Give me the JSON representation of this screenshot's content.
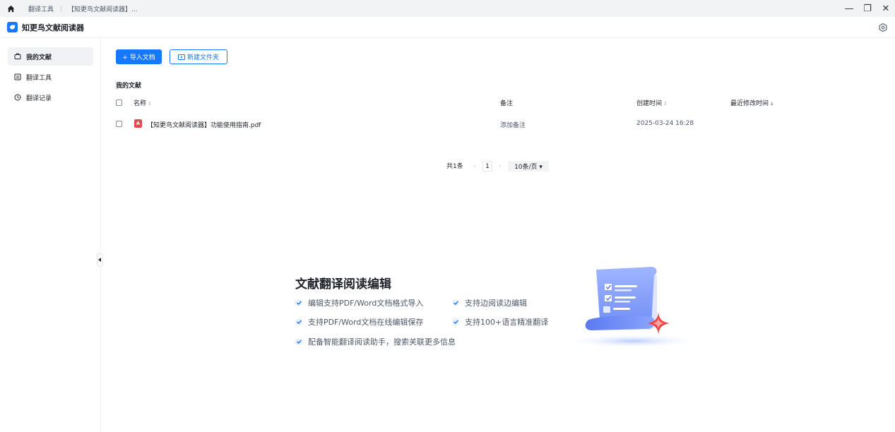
{
  "titlebar": {
    "tabs": [
      "翻译工具",
      "【知更鸟文献阅读器】..."
    ],
    "controls": {
      "minimize": "—",
      "restore": "❐",
      "close": "✕"
    }
  },
  "app": {
    "title": "知更鸟文献阅读器"
  },
  "sidebar": {
    "items": [
      {
        "label": "我的文献",
        "icon": "folder-icon",
        "active": true
      },
      {
        "label": "翻译工具",
        "icon": "translate-icon",
        "active": false
      },
      {
        "label": "翻译记录",
        "icon": "clock-icon",
        "active": false
      }
    ]
  },
  "toolbar": {
    "import_label": "+ 导入文档",
    "new_folder_label": "新建文件夹"
  },
  "section": {
    "title": "我的文献"
  },
  "table": {
    "headers": {
      "name": "名称",
      "note": "备注",
      "created": "创建时间",
      "modified": "最近修改时间"
    },
    "rows": [
      {
        "name": "【知更鸟文献阅读器】功能使用指南.pdf",
        "note": "添加备注",
        "created": "2025-03-24 16:28",
        "modified": ""
      }
    ]
  },
  "pagination": {
    "total": "共1条",
    "prev": "‹",
    "page": "1",
    "next": "›",
    "page_size": "10条/页 ▾"
  },
  "hero": {
    "title": "文献翻译阅读编辑",
    "features": [
      "编辑支持PDF/Word文档格式导入",
      "支持边阅读边编辑",
      "支持PDF/Word文档在线编辑保存",
      "支持100+语言精准翻译",
      "配备智能翻译阅读助手，搜索关联更多信息"
    ]
  },
  "colors": {
    "accent": "#1677ff",
    "pdf": "#e5484d",
    "sidebar_active": "#f0f2f5"
  }
}
